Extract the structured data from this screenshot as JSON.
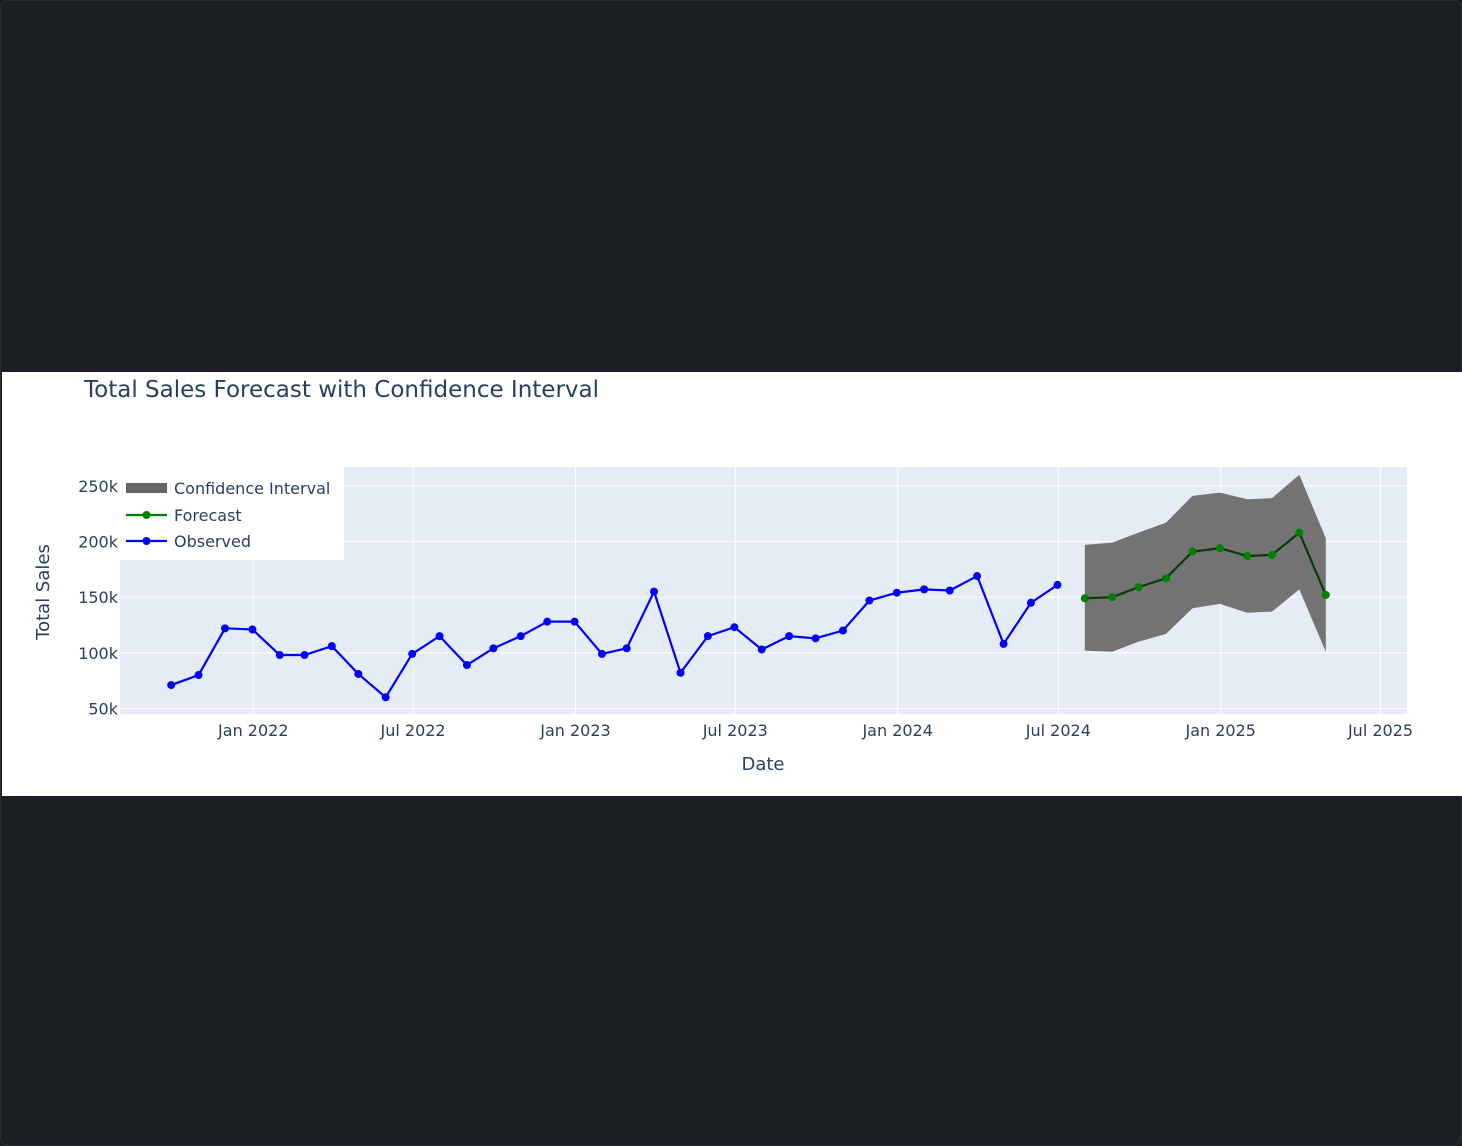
{
  "chart_data": {
    "type": "line",
    "title": "Total Sales Forecast with Confidence Interval",
    "xlabel": "Date",
    "ylabel": "Total Sales",
    "x_ticks": [
      "Jan 2022",
      "Jul 2022",
      "Jan 2023",
      "Jul 2023",
      "Jan 2024",
      "Jul 2024",
      "Jan 2025",
      "Jul 2025"
    ],
    "y_ticks": [
      "50k",
      "100k",
      "150k",
      "200k",
      "250k"
    ],
    "ylim": [
      45000,
      267000
    ],
    "xlim": [
      "2021-08-03",
      "2025-07-31"
    ],
    "grid": true,
    "legend_position": "top-left",
    "colors": {
      "observed": "#0000ff",
      "forecast": "#008000",
      "confidence": "#666666",
      "plot_bg": "#e5ecf6",
      "grid": "#ffffff"
    },
    "series": [
      {
        "name": "Observed",
        "x": [
          "2021-09-30",
          "2021-10-31",
          "2021-11-30",
          "2021-12-31",
          "2022-01-31",
          "2022-02-28",
          "2022-03-31",
          "2022-04-30",
          "2022-05-31",
          "2022-06-30",
          "2022-07-31",
          "2022-08-31",
          "2022-09-30",
          "2022-10-31",
          "2022-11-30",
          "2022-12-31",
          "2023-01-31",
          "2023-02-28",
          "2023-03-31",
          "2023-04-30",
          "2023-05-31",
          "2023-06-30",
          "2023-07-31",
          "2023-08-31",
          "2023-09-30",
          "2023-10-31",
          "2023-11-30",
          "2023-12-31",
          "2024-01-31",
          "2024-02-29",
          "2024-03-31",
          "2024-04-30",
          "2024-05-31",
          "2024-06-30",
          "2024-07-31"
        ],
        "values": [
          71000,
          80000,
          122000,
          121000,
          98000,
          98000,
          106000,
          81000,
          60000,
          99000,
          115000,
          89000,
          104000,
          115000,
          128000,
          128000,
          99000,
          104000,
          155000,
          82000,
          115000,
          123000,
          103000,
          115000,
          113000,
          120000,
          147000,
          154000,
          157000,
          156000,
          169000,
          108000,
          145000,
          161000,
          null
        ]
      },
      {
        "name": "Forecast",
        "x": [
          "2024-07-31",
          "2024-08-31",
          "2024-09-30",
          "2024-10-31",
          "2024-11-30",
          "2024-12-31",
          "2025-01-31",
          "2025-02-28",
          "2025-03-31",
          "2025-04-30"
        ],
        "values": [
          149000,
          150000,
          159000,
          167000,
          191000,
          194000,
          187000,
          188000,
          208000,
          152000
        ]
      },
      {
        "name": "Confidence Interval",
        "x": [
          "2024-07-31",
          "2024-08-31",
          "2024-09-30",
          "2024-10-31",
          "2024-11-30",
          "2024-12-31",
          "2025-01-31",
          "2025-02-28",
          "2025-03-31",
          "2025-04-30"
        ],
        "upper": [
          197000,
          199000,
          208000,
          217000,
          241000,
          244000,
          238000,
          239000,
          260000,
          203000
        ],
        "lower": [
          102000,
          101000,
          110000,
          117000,
          140000,
          144000,
          136000,
          137000,
          157000,
          101000
        ]
      }
    ]
  }
}
